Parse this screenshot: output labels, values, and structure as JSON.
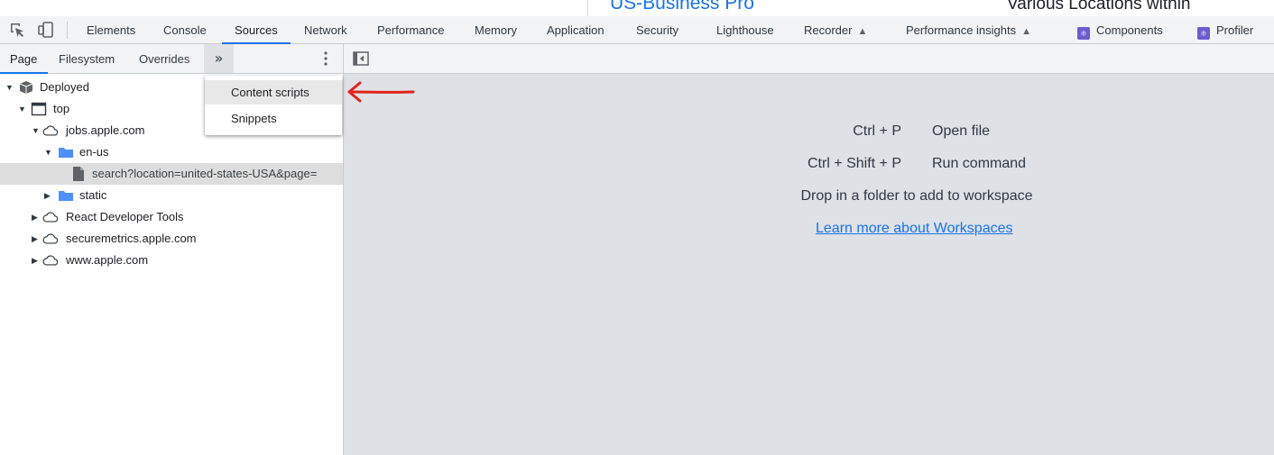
{
  "background_page": {
    "job_title": "US-Business Pro",
    "job_location": "Various Locations within"
  },
  "main_toolbar": {
    "tabs": [
      {
        "label": "Elements"
      },
      {
        "label": "Console"
      },
      {
        "label": "Sources"
      },
      {
        "label": "Network"
      },
      {
        "label": "Performance"
      },
      {
        "label": "Memory"
      },
      {
        "label": "Application"
      },
      {
        "label": "Security"
      },
      {
        "label": "Lighthouse"
      },
      {
        "label": "Recorder"
      },
      {
        "label": "Performance insights"
      },
      {
        "label": "Components"
      },
      {
        "label": "Profiler"
      }
    ],
    "active_tab": "Sources",
    "accent": "#1a73e8"
  },
  "navigator": {
    "tabs": [
      {
        "label": "Page"
      },
      {
        "label": "Filesystem"
      },
      {
        "label": "Overrides"
      }
    ],
    "more_tabs_glyph": "»",
    "tree": [
      {
        "label": "Deployed",
        "icon": "package-icon",
        "expanded": true
      },
      {
        "label": "top",
        "icon": "frame-icon",
        "expanded": true
      },
      {
        "label": "jobs.apple.com",
        "icon": "cloud-icon",
        "expanded": true
      },
      {
        "label": "en-us",
        "icon": "folder-icon",
        "expanded": true
      },
      {
        "label": "search?location=united-states-USA&page=",
        "icon": "file-icon",
        "selected": true
      },
      {
        "label": "static",
        "icon": "folder-icon",
        "expanded": false
      },
      {
        "label": "React Developer Tools",
        "icon": "cloud-icon",
        "expanded": false
      },
      {
        "label": "securemetrics.apple.com",
        "icon": "cloud-icon",
        "expanded": false
      },
      {
        "label": "www.apple.com",
        "icon": "cloud-icon",
        "expanded": false
      }
    ]
  },
  "dropdown_menu": {
    "items": [
      {
        "label": "Content scripts"
      },
      {
        "label": "Snippets"
      }
    ]
  },
  "editor_placeholder": {
    "shortcuts": [
      {
        "keys": "Ctrl + P",
        "desc": "Open file"
      },
      {
        "keys": "Ctrl + Shift + P",
        "desc": "Run command"
      }
    ],
    "drop_text": "Drop in a folder to add to workspace",
    "learn_more": "Learn more about Workspaces"
  },
  "annotation": {
    "color": "#e0241b"
  }
}
